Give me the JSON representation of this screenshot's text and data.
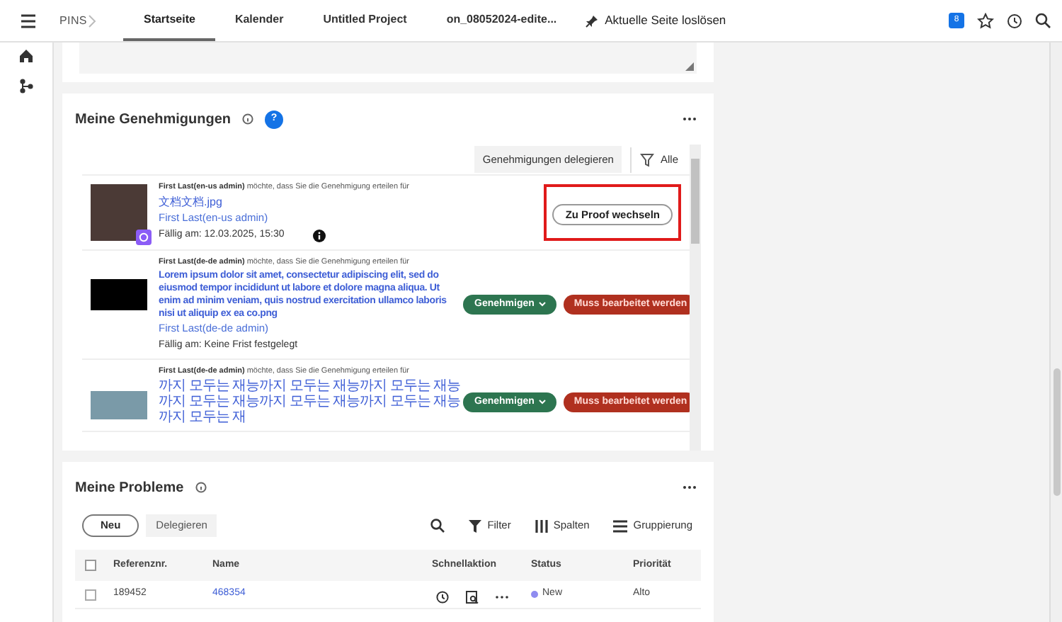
{
  "topbar": {
    "brand": "PINS",
    "tabs": [
      {
        "label": "Startseite",
        "selected": true
      },
      {
        "label": "Kalender",
        "selected": false
      },
      {
        "label": "Untitled Project",
        "selected": false
      },
      {
        "label": "on_08052024-edite...",
        "selected": false
      }
    ],
    "unpin": "Aktuelle Seite loslösen",
    "badge": "8"
  },
  "approvals": {
    "title": "Meine Genehmigungen",
    "help": "?",
    "delegate": "Genehmigungen delegieren",
    "filter": "Alle",
    "items": [
      {
        "kind": "proof",
        "thumbnail": {
          "kind": "photo"
        },
        "requester": "First Last(en-us admin)",
        "request": "möchte, dass Sie die Genehmigung erteilen für",
        "file": "文档文档.jpg",
        "name": "First Last(en-us admin)",
        "due": "Fällig am: 12.03.2025, 15:30",
        "info": true,
        "button": "Zu Proof wechseln"
      },
      {
        "kind": "decision",
        "thumbnail": {
          "kind": "dark"
        },
        "requester": "First Last(de-de admin)",
        "request": "möchte, dass Sie die Genehmigung erteilen für",
        "file": "Lorem ipsum dolor sit amet, consectetur adipiscing elit, sed do eiusmod tempor incididunt ut labore et dolore magna aliqua. Ut enim ad minim veniam, quis nostrud exercitation ullamco laboris nisi ut aliquip ex ea co.png",
        "name": "First Last(de-de admin)",
        "due": "Fällig am: Keine Frist festgelegt",
        "info": false,
        "approve": "Genehmigen",
        "reject": "Muss bearbeitet werden"
      },
      {
        "kind": "decision",
        "thumbnail": {
          "kind": "landscape"
        },
        "requester": "First Last(de-de admin)",
        "request": "möchte, dass Sie die Genehmigung erteilen für",
        "file": "까지 모두는 재능까지 모두는 재능까지 모두는 재능까지 모두는 재능까지 모두는 재능까지 모두는 재능까지 모두는 재",
        "approve": "Genehmigen",
        "reject": "Muss bearbeitet werden"
      }
    ]
  },
  "problems": {
    "title": "Meine Probleme",
    "new": "Neu",
    "delegate": "Delegieren",
    "filter": "Filter",
    "columns": "Spalten",
    "grouping": "Gruppierung",
    "table": {
      "columns": [
        "Referenznr.",
        "Name",
        "Schnellaktion",
        "Status",
        "Priorität"
      ],
      "all_checked": false,
      "rows": [
        {
          "checked": false,
          "ref": "189452",
          "name": "468354",
          "status": "New",
          "color": "#8f8cf0",
          "priority": "Alto"
        }
      ]
    }
  }
}
